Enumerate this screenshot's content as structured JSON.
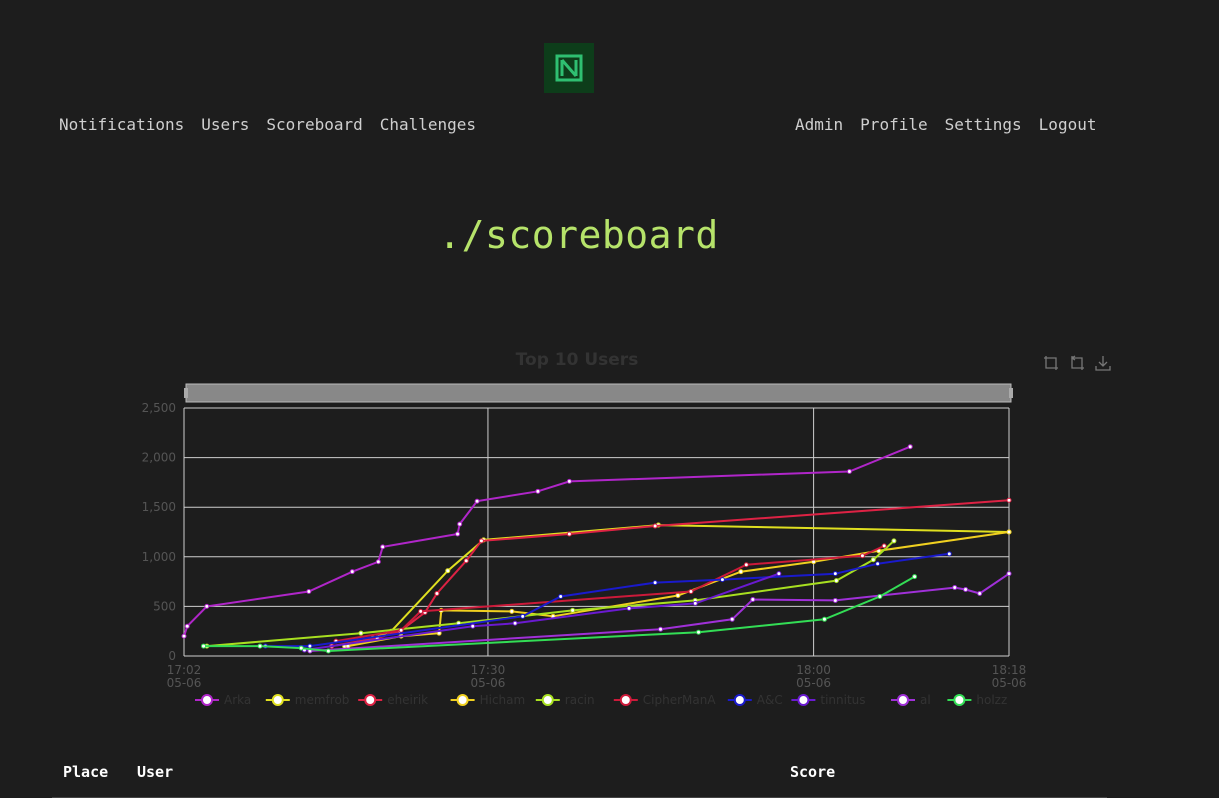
{
  "nav": {
    "left": [
      "Notifications",
      "Users",
      "Scoreboard",
      "Challenges"
    ],
    "right": [
      "Admin",
      "Profile",
      "Settings",
      "Logout"
    ]
  },
  "page_title": "./scoreboard",
  "table": {
    "headers": {
      "place": "Place",
      "user": "User",
      "score": "Score"
    }
  },
  "colors": {
    "background": "#1d1d1d",
    "title": "#b6e36a",
    "logo": "#2fbf71"
  },
  "chart_data": {
    "type": "line",
    "title": "Top 10 Users",
    "ylim": [
      0,
      2500
    ],
    "y_ticks": [
      "0",
      "500",
      "1,000",
      "1,500",
      "2,000",
      "2,500"
    ],
    "x_ticks": [
      {
        "time": "17:02",
        "date": "05-06"
      },
      {
        "time": "17:30",
        "date": "05-06"
      },
      {
        "time": "18:00",
        "date": "05-06"
      },
      {
        "time": "18:18",
        "date": "05-06"
      }
    ],
    "x_range_minutes": [
      1022,
      1098
    ],
    "grid": true,
    "legend_position": "bottom",
    "toolbox": [
      "zoom-icon",
      "zoom-reset-icon",
      "download-icon"
    ],
    "series": [
      {
        "name": "Arka",
        "color": "#b026c9",
        "points": [
          [
            1022.0,
            200
          ],
          [
            1022.3,
            300
          ],
          [
            1024.1,
            500
          ],
          [
            1033.5,
            650
          ],
          [
            1037.5,
            850
          ],
          [
            1039.9,
            950
          ],
          [
            1040.3,
            1100
          ],
          [
            1047.2,
            1230
          ],
          [
            1047.4,
            1330
          ],
          [
            1049.0,
            1560
          ],
          [
            1054.6,
            1660
          ],
          [
            1057.5,
            1760
          ],
          [
            1083.3,
            1860
          ],
          [
            1088.9,
            2110
          ]
        ]
      },
      {
        "name": "memfrob",
        "color": "#e0e020",
        "points": [
          [
            1036.8,
            100
          ],
          [
            1039.4,
            180
          ],
          [
            1041.1,
            250
          ],
          [
            1046.3,
            860
          ],
          [
            1049.6,
            1170
          ],
          [
            1065.7,
            1320
          ],
          [
            1098.0,
            1250
          ]
        ]
      },
      {
        "name": "eheirik",
        "color": "#dd2244",
        "points": [
          [
            1035.6,
            100
          ],
          [
            1039.8,
            180
          ],
          [
            1041.9,
            250
          ],
          [
            1044.2,
            440
          ],
          [
            1045.3,
            630
          ],
          [
            1048.0,
            960
          ],
          [
            1049.4,
            1160
          ],
          [
            1057.5,
            1230
          ],
          [
            1065.4,
            1310
          ],
          [
            1098.0,
            1570
          ]
        ]
      },
      {
        "name": "Hicham",
        "color": "#f0d020",
        "points": [
          [
            1037.1,
            100
          ],
          [
            1042.0,
            200
          ],
          [
            1045.5,
            230
          ],
          [
            1045.7,
            460
          ],
          [
            1052.2,
            450
          ],
          [
            1056.0,
            400
          ],
          [
            1067.5,
            610
          ],
          [
            1073.3,
            850
          ],
          [
            1080.0,
            950
          ],
          [
            1086.0,
            1060
          ],
          [
            1098.0,
            1250
          ]
        ]
      },
      {
        "name": "racin",
        "color": "#a8e020",
        "points": [
          [
            1024.1,
            100
          ],
          [
            1038.3,
            230
          ],
          [
            1047.3,
            330
          ],
          [
            1057.8,
            460
          ],
          [
            1069.1,
            560
          ],
          [
            1082.1,
            760
          ],
          [
            1085.5,
            970
          ],
          [
            1087.4,
            1160
          ]
        ]
      },
      {
        "name": "CipherManA",
        "color": "#cc1a3a",
        "points": [
          [
            1036.0,
            150
          ],
          [
            1042.0,
            260
          ],
          [
            1043.8,
            450
          ],
          [
            1068.7,
            650
          ],
          [
            1073.8,
            920
          ],
          [
            1084.5,
            1010
          ],
          [
            1086.5,
            1110
          ]
        ]
      },
      {
        "name": "A&C",
        "color": "#1a1acc",
        "points": [
          [
            1029.5,
            100
          ],
          [
            1033.6,
            100
          ],
          [
            1053.2,
            400
          ],
          [
            1056.7,
            600
          ],
          [
            1065.4,
            740
          ],
          [
            1071.6,
            770
          ],
          [
            1082.0,
            830
          ],
          [
            1085.9,
            930
          ],
          [
            1092.5,
            1030
          ]
        ]
      },
      {
        "name": "tinnitus",
        "color": "#6a1ad0",
        "points": [
          [
            1033.1,
            60
          ],
          [
            1048.6,
            300
          ],
          [
            1052.5,
            330
          ],
          [
            1063.0,
            480
          ],
          [
            1069.1,
            530
          ],
          [
            1076.8,
            830
          ]
        ]
      },
      {
        "name": "al",
        "color": "#a030d8",
        "points": [
          [
            1033.6,
            50
          ],
          [
            1065.9,
            270
          ],
          [
            1072.5,
            370
          ],
          [
            1074.4,
            570
          ],
          [
            1082.0,
            560
          ],
          [
            1093.0,
            690
          ],
          [
            1094.0,
            670
          ],
          [
            1095.3,
            630
          ],
          [
            1098.0,
            830
          ]
        ]
      },
      {
        "name": "holzz",
        "color": "#33dd55",
        "points": [
          [
            1023.8,
            100
          ],
          [
            1029.0,
            100
          ],
          [
            1032.8,
            80
          ],
          [
            1035.3,
            50
          ],
          [
            1069.4,
            240
          ],
          [
            1081.0,
            370
          ],
          [
            1086.1,
            600
          ],
          [
            1089.3,
            800
          ]
        ]
      }
    ]
  }
}
